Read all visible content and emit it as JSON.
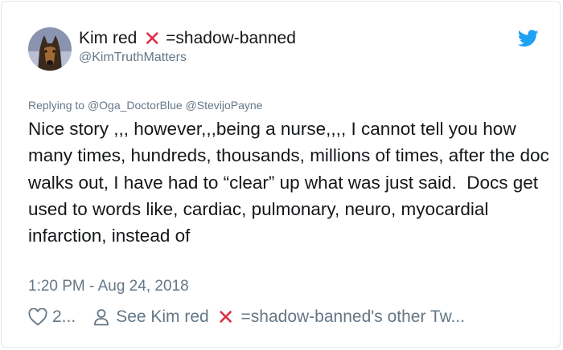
{
  "user": {
    "display_name_prefix": "Kim red",
    "display_name_suffix": "=shadow-banned",
    "handle": "@KimTruthMatters",
    "avatar_icon": "dog-avatar",
    "platform_icon": "twitter-bird-icon",
    "brand_color": "#1da1f2"
  },
  "tweet": {
    "reply_prefix": "Replying to",
    "reply_mentions": "@Oga_DoctorBlue @StevijoPayne",
    "text": "Nice story ,,, however,,,being a nurse,,,, I cannot tell you how many times, hundreds, thousands, millions of times, after the doc walks out, I have had to “clear” up what was just said.  Docs get used to words like, cardiac, pulmonary, neuro, myocardial infarction, instead of",
    "timestamp": "1:20 PM - Aug 24, 2018"
  },
  "footer": {
    "like_count": "2...",
    "like_icon": "heart-icon",
    "profile_icon": "person-icon",
    "other_tweets_prefix": "See Kim red",
    "other_tweets_suffix": "=shadow-banned's other Tw..."
  },
  "colors": {
    "text": "#14171a",
    "secondary": "#657786",
    "x_mark": "#dd2e44",
    "border": "#e1e8ed"
  }
}
